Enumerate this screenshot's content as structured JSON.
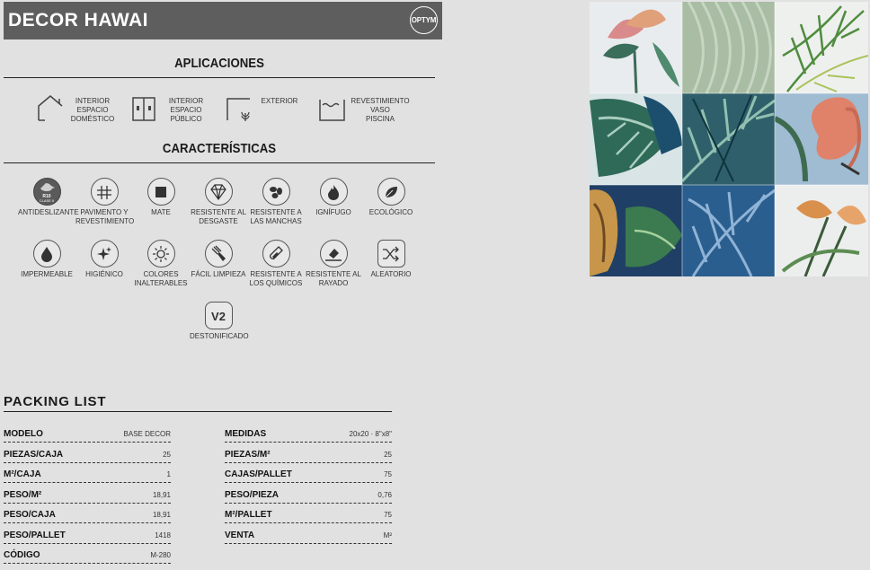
{
  "header": {
    "title": "DECOR HAWAI",
    "logo": "OPTYM"
  },
  "aplicaciones": {
    "title": "APLICACIONES",
    "items": [
      {
        "label": "INTERIOR\nESPACIO\nDOMÉSTICO",
        "icon": "house-icon"
      },
      {
        "label": "INTERIOR\nESPACIO\nPÚBLICO",
        "icon": "building-icon"
      },
      {
        "label": "EXTERIOR",
        "icon": "exterior-plant-icon"
      },
      {
        "label": "REVESTIMIENTO\nVASO\nPISCINA",
        "icon": "pool-icon"
      }
    ]
  },
  "caracteristicas": {
    "title": "CARACTERÍSTICAS",
    "badge": "R10\nCLASE II",
    "items": [
      {
        "label": "ANTIDESLIZANTE",
        "icon": "antislip-icon"
      },
      {
        "label": "PAVIMENTO Y\nREVESTIMIENTO",
        "icon": "floor-wall-icon"
      },
      {
        "label": "MATE",
        "icon": "matte-square-icon"
      },
      {
        "label": "RESISTENTE AL\nDESGASTE",
        "icon": "diamond-icon"
      },
      {
        "label": "RESISTENTE A\nLAS MANCHAS",
        "icon": "stain-icon"
      },
      {
        "label": "IGNÍFUGO",
        "icon": "flame-icon"
      },
      {
        "label": "ECOLÓGICO",
        "icon": "leaf-icon"
      },
      {
        "label": "IMPERMEABLE",
        "icon": "water-drop-icon"
      },
      {
        "label": "HIGIÉNICO",
        "icon": "sparkle-icon"
      },
      {
        "label": "COLORES\nINALTERABLES",
        "icon": "sun-icon"
      },
      {
        "label": "FÁCIL LIMPIEZA",
        "icon": "cleaning-icon"
      },
      {
        "label": "RESISTENTE A\nLOS QUÍMICOS",
        "icon": "chemical-icon"
      },
      {
        "label": "RESISTENTE AL\nRAYADO",
        "icon": "scratch-icon"
      },
      {
        "label": "ALEATORIO",
        "icon": "shuffle-icon"
      },
      {
        "label": "DESTONIFICADO",
        "icon": "v2-icon"
      }
    ]
  },
  "packing": {
    "title": "PACKING LIST",
    "left": [
      {
        "key": "MODELO",
        "value": "BASE DECOR"
      },
      {
        "key": "PIEZAS/CAJA",
        "value": "25"
      },
      {
        "key": "M²/CAJA",
        "value": "1"
      },
      {
        "key": "PESO/M²",
        "value": "18,91"
      },
      {
        "key": "PESO/CAJA",
        "value": "18,91"
      },
      {
        "key": "PESO/PALLET",
        "value": "1418"
      },
      {
        "key": "CÓDIGO",
        "value": "M-280"
      }
    ],
    "right": [
      {
        "key": "MEDIDAS",
        "value": "20x20 · 8\"x8\""
      },
      {
        "key": "PIEZAS/M²",
        "value": "25"
      },
      {
        "key": "CAJAS/PALLET",
        "value": "75"
      },
      {
        "key": "PESO/PIEZA",
        "value": "0,76"
      },
      {
        "key": "M²/PALLET",
        "value": "75"
      },
      {
        "key": "VENTA",
        "value": "M²"
      }
    ]
  }
}
